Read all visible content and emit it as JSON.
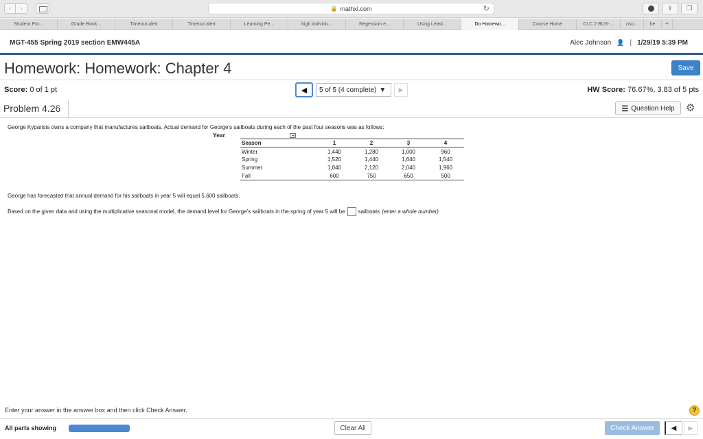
{
  "browser": {
    "url": "mathxl.com",
    "tabs": [
      {
        "label": "Student Por...",
        "active": false
      },
      {
        "label": "Grade Book...",
        "active": false
      },
      {
        "label": "Timeout alert",
        "active": false
      },
      {
        "label": "Timeout alert",
        "active": false
      },
      {
        "label": "Learning Pe...",
        "active": false
      },
      {
        "label": "high individu...",
        "active": false
      },
      {
        "label": "Regession e...",
        "active": false
      },
      {
        "label": "Using Least...",
        "active": false
      },
      {
        "label": "Do Homewo...",
        "active": true
      },
      {
        "label": "Course Home",
        "active": false
      },
      {
        "label": "CLC 2 BUS-...",
        "active": false
      },
      {
        "label": "nso...",
        "active": false
      },
      {
        "label": "he",
        "active": false
      }
    ],
    "add_tab": "+"
  },
  "course": {
    "title": "MGT-455 Spring 2019 section EMW445A",
    "user": "Alec Johnson",
    "separator": "|",
    "datetime": "1/29/19 5:39 PM"
  },
  "homework": {
    "title": "Homework: Homework: Chapter 4",
    "save_label": "Save",
    "score_label": "Score:",
    "score_value": "0 of 1 pt",
    "nav_select": "5 of 5 (4 complete)",
    "hw_score_label": "HW Score:",
    "hw_score_value": "76.67%, 3.83 of 5 pts",
    "problem": "Problem 4.26",
    "question_help": "Question Help"
  },
  "question": {
    "intro": "George Kyparisis owns a company that manufactures sailboats. Actual demand for George's sailboats during each of the past four seasons was as follows:",
    "year_label": "Year",
    "table": {
      "headers": [
        "Season",
        "1",
        "2",
        "3",
        "4"
      ],
      "rows": [
        [
          "Winter",
          "1,440",
          "1,280",
          "1,000",
          "960"
        ],
        [
          "Spring",
          "1,520",
          "1,440",
          "1,640",
          "1,540"
        ],
        [
          "Summer",
          "1,040",
          "2,120",
          "2,040",
          "1,960"
        ],
        [
          "Fall",
          "600",
          "750",
          "650",
          "500"
        ]
      ]
    },
    "forecast": "George has forecasted that annual demand for his sailboats in year 5 will equal 5,600 sailboats.",
    "based_text": "Based on the given data and using the multiplicative seasonal model, the demand level for George's sailboats in the spring of year 5 will be",
    "answer_value": "",
    "answer_suffix": "sailboats",
    "answer_note": "(enter a whole number)."
  },
  "footer": {
    "instruction": "Enter your answer in the answer box and then click Check Answer.",
    "parts_label": "All parts showing",
    "progress_fraction": 1.0,
    "clear_all": "Clear All",
    "check_answer": "Check Answer"
  },
  "colors": {
    "brand_blue": "#2b5c8a",
    "button_blue": "#3c83c9",
    "disabled_blue": "#9bbce0"
  }
}
